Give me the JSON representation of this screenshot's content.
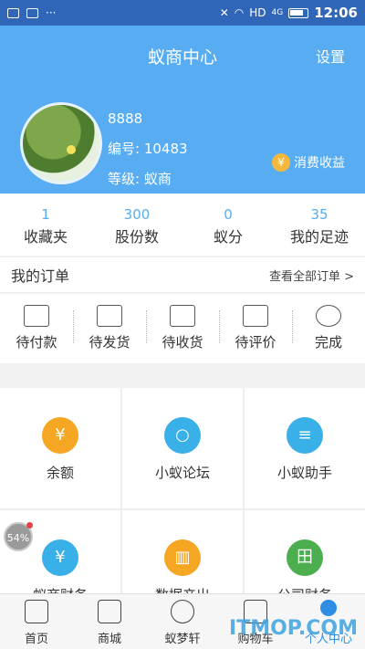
{
  "status_bar": {
    "network": "HD",
    "signal_label": "4G",
    "time": "12:06"
  },
  "header": {
    "title": "蚁商中心",
    "settings": "设置"
  },
  "user": {
    "name": "8888",
    "id_label": "编号: 10483",
    "level_label": "等级: 蚁商",
    "income": "消费收益"
  },
  "stats": [
    {
      "value": "1",
      "label": "收藏夹"
    },
    {
      "value": "300",
      "label": "股份数"
    },
    {
      "value": "0",
      "label": "蚁分"
    },
    {
      "value": "35",
      "label": "我的足迹"
    }
  ],
  "orders": {
    "title": "我的订单",
    "view_all": "查看全部订单 >",
    "items": [
      "待付款",
      "待发货",
      "待收货",
      "待评价",
      "完成"
    ]
  },
  "services": [
    {
      "label": "余额",
      "icon": "money-bag-icon",
      "color": "#f5a623",
      "glyph": "¥"
    },
    {
      "label": "小蚁论坛",
      "icon": "forum-icon",
      "color": "#3ab0e8",
      "glyph": "○"
    },
    {
      "label": "小蚁助手",
      "icon": "assistant-icon",
      "color": "#3ab0e8",
      "glyph": "≡"
    },
    {
      "label": "蚁商财务",
      "icon": "finance-icon",
      "color": "#3ab0e8",
      "glyph": "¥"
    },
    {
      "label": "数据产出",
      "icon": "chart-icon",
      "color": "#f5a623",
      "glyph": "▥"
    },
    {
      "label": "公司财务",
      "icon": "company-finance-icon",
      "color": "#4cae4f",
      "glyph": "田"
    }
  ],
  "float_badge": "54%",
  "tabs": [
    {
      "label": "首页",
      "icon": "home-icon"
    },
    {
      "label": "商城",
      "icon": "mall-icon"
    },
    {
      "label": "蚁梦轩",
      "icon": "planet-icon"
    },
    {
      "label": "购物车",
      "icon": "cart-icon"
    },
    {
      "label": "个人中心",
      "icon": "profile-icon"
    }
  ],
  "watermark": "ITMOP.COM"
}
